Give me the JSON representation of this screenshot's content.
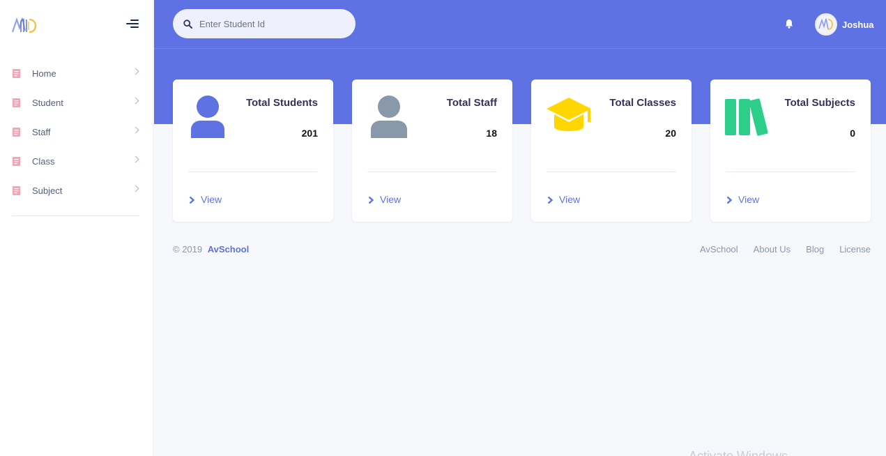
{
  "search": {
    "placeholder": "Enter Student Id"
  },
  "user": {
    "name": "Joshua"
  },
  "sidebar": {
    "items": [
      {
        "label": "Home"
      },
      {
        "label": "Student"
      },
      {
        "label": "Staff"
      },
      {
        "label": "Class"
      },
      {
        "label": "Subject"
      }
    ]
  },
  "cards": [
    {
      "title": "Total Students",
      "value": "201",
      "link_label": "View",
      "icon": "user-icon",
      "icon_color": "#5e72e4"
    },
    {
      "title": "Total Staff",
      "value": "18",
      "link_label": "View",
      "icon": "user-icon",
      "icon_color": "#8a98ab"
    },
    {
      "title": "Total Classes",
      "value": "20",
      "link_label": "View",
      "icon": "graduation-cap-icon",
      "icon_color": "#ffd600"
    },
    {
      "title": "Total Subjects",
      "value": "0",
      "link_label": "View",
      "icon": "books-icon",
      "icon_color": "#2dce89"
    }
  ],
  "footer": {
    "copyright": "© 2019",
    "brand": "AvSchool",
    "links": [
      "AvSchool",
      "About Us",
      "Blog",
      "License"
    ]
  },
  "watermark": "Activate Windows",
  "colors": {
    "primary": "#5e72e4",
    "sidebar_icon": "#f3a4b5",
    "background": "#f7f8fc"
  }
}
